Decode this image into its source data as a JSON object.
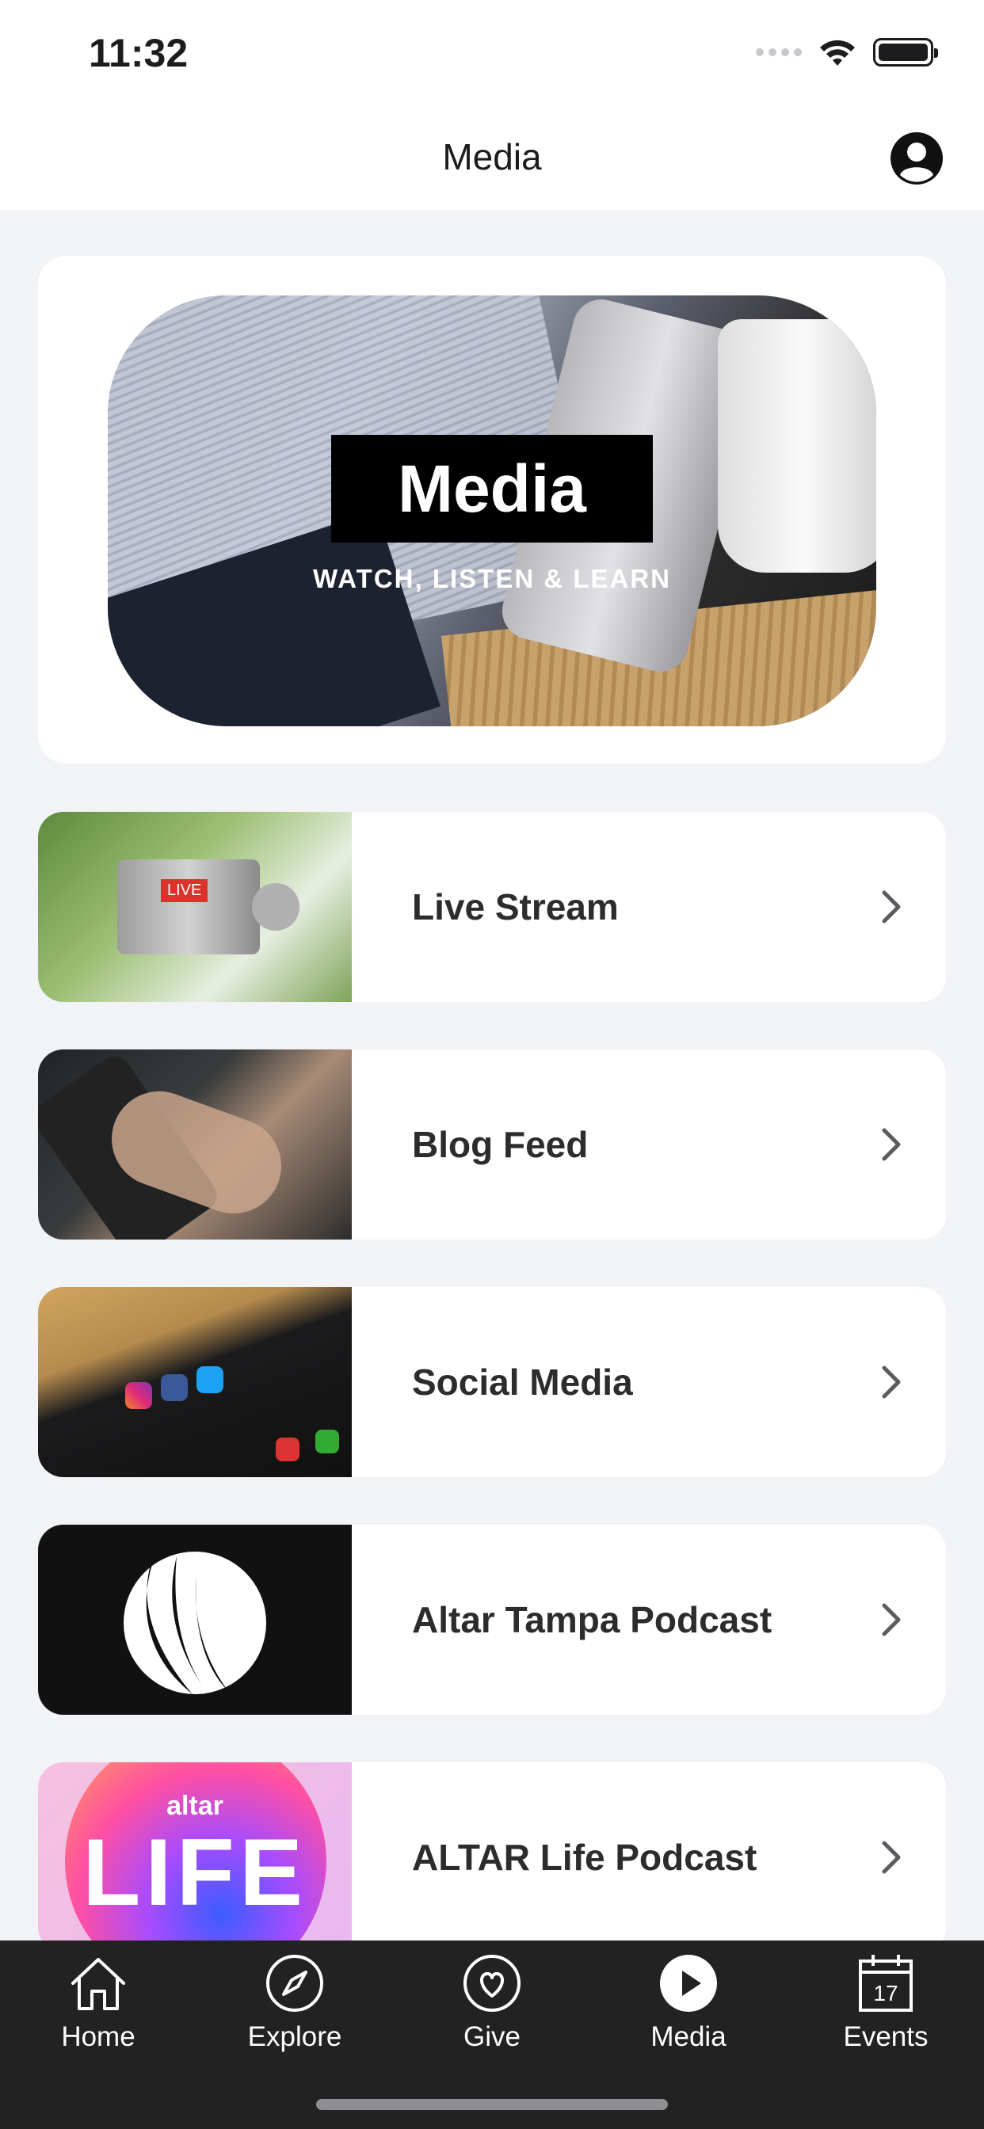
{
  "status_bar": {
    "time": "11:32"
  },
  "nav": {
    "title": "Media",
    "profile_icon": "person-circle-icon"
  },
  "hero": {
    "title": "Media",
    "subtitle": "WATCH, LISTEN & LEARN"
  },
  "items": [
    {
      "label": "Live Stream",
      "thumb_badge": "LIVE"
    },
    {
      "label": "Blog Feed"
    },
    {
      "label": "Social Media"
    },
    {
      "label": "Altar Tampa Podcast"
    },
    {
      "label": "ALTAR Life Podcast",
      "thumb_text_top": "altar",
      "thumb_text_main": "LIFE"
    }
  ],
  "tabs": [
    {
      "label": "Home",
      "icon": "house-icon"
    },
    {
      "label": "Explore",
      "icon": "compass-icon"
    },
    {
      "label": "Give",
      "icon": "heart-circle-icon"
    },
    {
      "label": "Media",
      "icon": "play-circle-icon",
      "active": true
    },
    {
      "label": "Events",
      "icon": "calendar-icon",
      "calendar_day": "17"
    }
  ],
  "colors": {
    "background": "#f2f3f7",
    "tab_bar": "#222222",
    "live_badge": "#d9342b"
  }
}
